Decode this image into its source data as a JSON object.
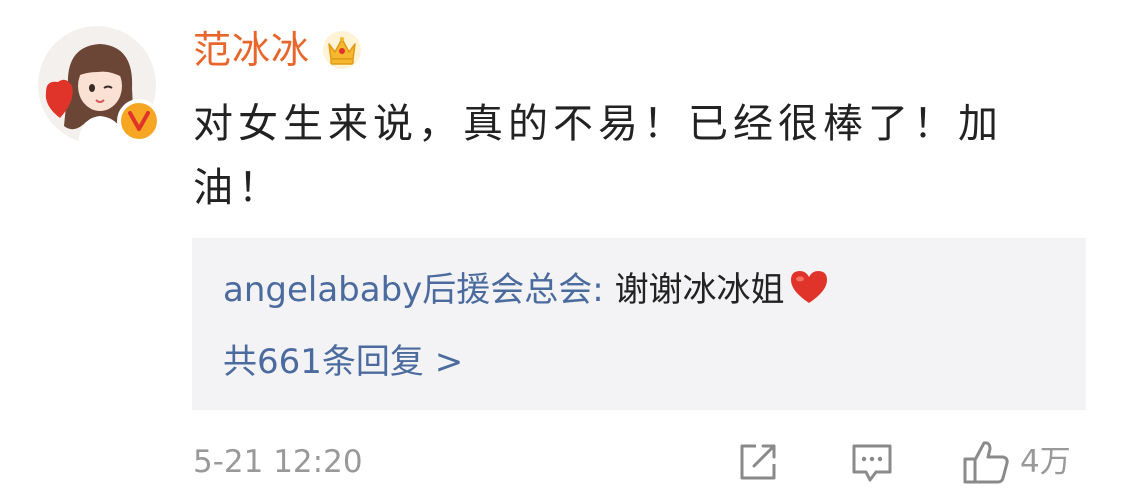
{
  "comment": {
    "username": "范冰冰",
    "crown_icon": "crown-icon",
    "verified_badge": "V",
    "text": "对女生来说，真的不易！已经很棒了！加油！",
    "reply": {
      "author": "angelababy后援会总会",
      "colon": ": ",
      "text": "谢谢冰冰姐",
      "heart_icon": "heart-icon"
    },
    "reply_count_text": "共661条回复 >",
    "timestamp": "5-21 12:20",
    "actions": {
      "share_icon": "share-icon",
      "comment_icon": "comment-icon",
      "like_icon": "thumbs-up-icon",
      "like_count": "4万"
    }
  },
  "colors": {
    "username": "#e8662c",
    "link_blue": "#4b6b9e",
    "reply_bg": "#f3f3f5",
    "meta_gray": "#999999",
    "badge_orange": "#f6a623"
  }
}
